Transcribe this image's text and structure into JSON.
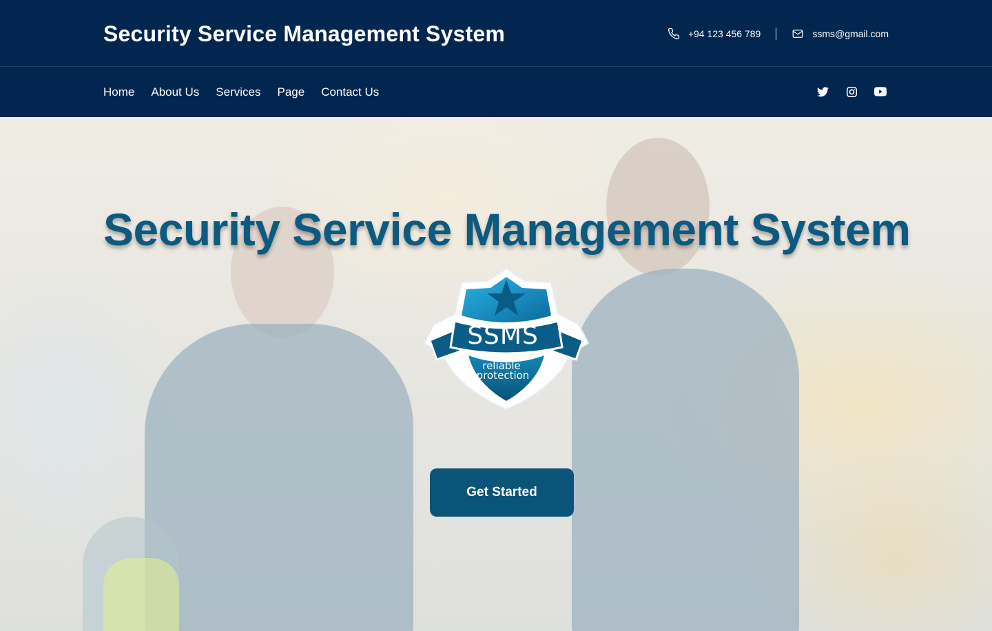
{
  "header": {
    "brand": "Security Service Management System",
    "phone": "+94 123 456 789",
    "email": "ssms@gmail.com"
  },
  "nav": {
    "items": [
      {
        "label": "Home"
      },
      {
        "label": "About Us"
      },
      {
        "label": "Services"
      },
      {
        "label": "Page"
      },
      {
        "label": "Contact Us"
      }
    ],
    "social": [
      "twitter-icon",
      "instagram-icon",
      "youtube-icon"
    ]
  },
  "hero": {
    "title": "Security Service Management System",
    "cta_label": "Get Started",
    "logo": {
      "acronym": "SSMS",
      "tagline_line1": "reliable",
      "tagline_line2": "protection"
    }
  },
  "colors": {
    "navy": "#02264f",
    "accent": "#0a5479",
    "title": "#0d5a80"
  }
}
